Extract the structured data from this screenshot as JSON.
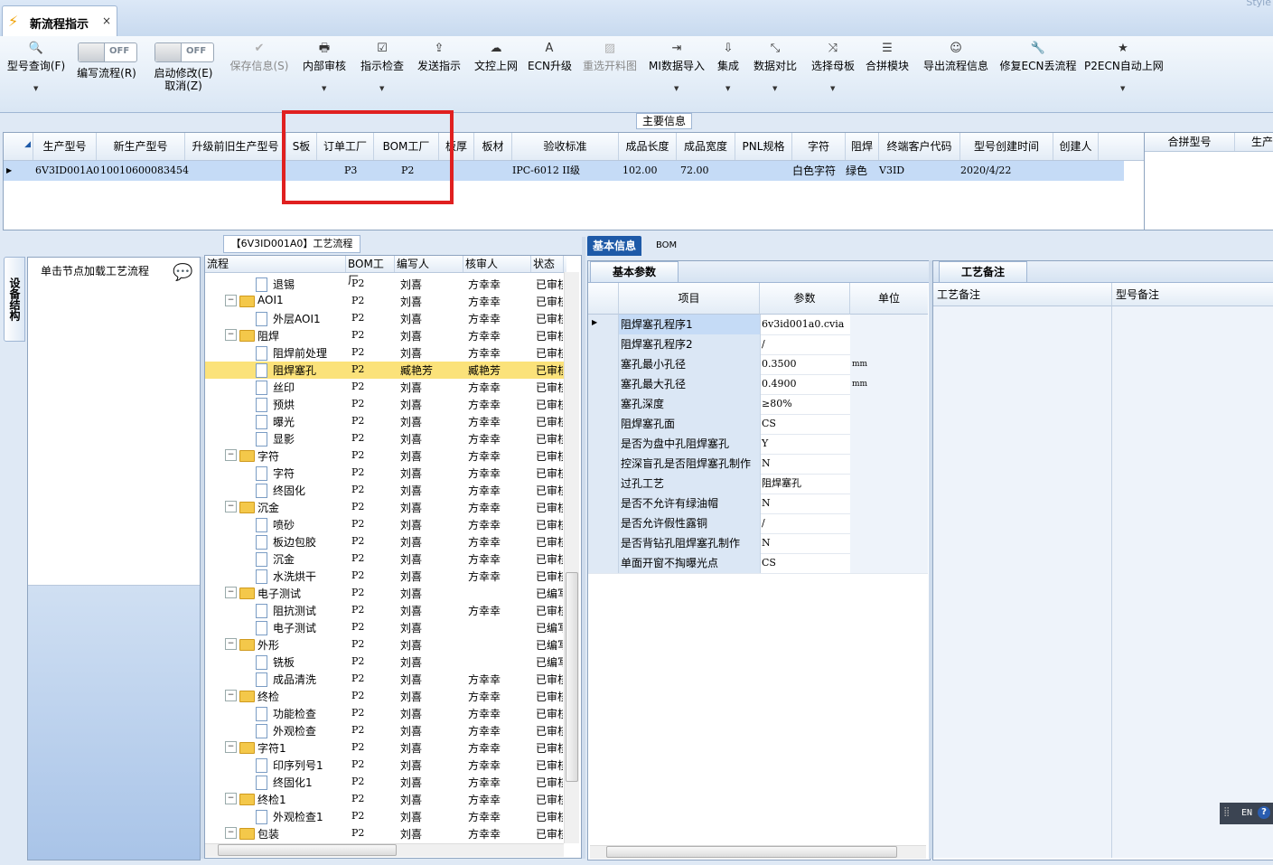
{
  "window": {
    "tab_title": "新流程指示",
    "close_glyph": "×",
    "style_label": "Style"
  },
  "toolbar": {
    "items": [
      {
        "label": "型号查询(F)",
        "icon": "🔍",
        "dropdown": true
      },
      {
        "label": "编写流程(R)",
        "toggle": "OFF"
      },
      {
        "label": "启动修改(E)",
        "label2": "取消(Z)",
        "toggle": "OFF"
      },
      {
        "label": "保存信息(S)",
        "icon": "✔",
        "disabled": true
      },
      {
        "label": "内部审核",
        "icon": "🖶",
        "dropdown": true
      },
      {
        "label": "指示检查",
        "icon": "☑",
        "dropdown": true
      },
      {
        "label": "发送指示",
        "icon": "⇪"
      },
      {
        "label": "文控上网",
        "icon": "☁"
      },
      {
        "label": "ECN升级",
        "icon": "A"
      },
      {
        "label": "重选开料图",
        "icon": "▨",
        "disabled": true
      },
      {
        "label": "MI数据导入",
        "icon": "⇥",
        "dropdown": true
      },
      {
        "label": "集成",
        "icon": "⇩",
        "dropdown": true
      },
      {
        "label": "数据对比",
        "icon": "⤡",
        "dropdown": true
      },
      {
        "label": "选择母板",
        "icon": "⤨",
        "dropdown": true
      },
      {
        "label": "合拼模块",
        "icon": "☰"
      },
      {
        "label": "导出流程信息",
        "icon": "☺"
      },
      {
        "label": "修复ECN丢流程",
        "icon": "🔧"
      },
      {
        "label": "P2ECN自动上网",
        "icon": "★",
        "dropdown": true
      }
    ]
  },
  "main_info": {
    "title": "主要信息",
    "columns": [
      "生产型号",
      "新生产型号",
      "升级前旧生产型号",
      "S板",
      "订单工厂",
      "BOM工厂",
      "板厚",
      "板材",
      "验收标准",
      "成品长度",
      "成品宽度",
      "PNL规格",
      "字符",
      "阻焊",
      "终端客户代码",
      "型号创建时间",
      "创建人"
    ],
    "row": [
      "6V3ID001A0",
      "10010600083454",
      "",
      "",
      "P3",
      "P2",
      "",
      "",
      "IPC-6012 II级",
      "102.00",
      "72.00",
      "",
      "白色字符",
      "绿色",
      "V3ID",
      "2020/4/22",
      ""
    ],
    "merge_columns": [
      "合拼型号",
      "生产"
    ]
  },
  "left_panel": {
    "side_tab": "设备结构",
    "load_hint": "单击节点加载工艺流程"
  },
  "tree": {
    "title": "【6V3ID001A0】工艺流程",
    "columns": [
      "流程",
      "BOM工厂",
      "编写人",
      "核审人",
      "状态"
    ],
    "rows": [
      {
        "level": 2,
        "name": "退锡",
        "bom": "P2",
        "writer": "刘喜",
        "reviewer": "方幸幸",
        "status": "已审核"
      },
      {
        "level": 1,
        "name": "AOI1",
        "bom": "P2",
        "writer": "刘喜",
        "reviewer": "方幸幸",
        "status": "已审核"
      },
      {
        "level": 2,
        "name": "外层AOI1",
        "bom": "P2",
        "writer": "刘喜",
        "reviewer": "方幸幸",
        "status": "已审核"
      },
      {
        "level": 1,
        "name": "阻焊",
        "bom": "P2",
        "writer": "刘喜",
        "reviewer": "方幸幸",
        "status": "已审核"
      },
      {
        "level": 2,
        "name": "阻焊前处理",
        "bom": "P2",
        "writer": "刘喜",
        "reviewer": "方幸幸",
        "status": "已审核"
      },
      {
        "level": 2,
        "name": "阻焊塞孔",
        "bom": "P2",
        "writer": "臧艳芳",
        "reviewer": "臧艳芳",
        "status": "已审核",
        "selected": true
      },
      {
        "level": 2,
        "name": "丝印",
        "bom": "P2",
        "writer": "刘喜",
        "reviewer": "方幸幸",
        "status": "已审核"
      },
      {
        "level": 2,
        "name": "预烘",
        "bom": "P2",
        "writer": "刘喜",
        "reviewer": "方幸幸",
        "status": "已审核"
      },
      {
        "level": 2,
        "name": "曝光",
        "bom": "P2",
        "writer": "刘喜",
        "reviewer": "方幸幸",
        "status": "已审核"
      },
      {
        "level": 2,
        "name": "显影",
        "bom": "P2",
        "writer": "刘喜",
        "reviewer": "方幸幸",
        "status": "已审核"
      },
      {
        "level": 1,
        "name": "字符",
        "bom": "P2",
        "writer": "刘喜",
        "reviewer": "方幸幸",
        "status": "已审核"
      },
      {
        "level": 2,
        "name": "字符",
        "bom": "P2",
        "writer": "刘喜",
        "reviewer": "方幸幸",
        "status": "已审核"
      },
      {
        "level": 2,
        "name": "终固化",
        "bom": "P2",
        "writer": "刘喜",
        "reviewer": "方幸幸",
        "status": "已审核"
      },
      {
        "level": 1,
        "name": "沉金",
        "bom": "P2",
        "writer": "刘喜",
        "reviewer": "方幸幸",
        "status": "已审核"
      },
      {
        "level": 2,
        "name": "喷砂",
        "bom": "P2",
        "writer": "刘喜",
        "reviewer": "方幸幸",
        "status": "已审核"
      },
      {
        "level": 2,
        "name": "板边包胶",
        "bom": "P2",
        "writer": "刘喜",
        "reviewer": "方幸幸",
        "status": "已审核"
      },
      {
        "level": 2,
        "name": "沉金",
        "bom": "P2",
        "writer": "刘喜",
        "reviewer": "方幸幸",
        "status": "已审核"
      },
      {
        "level": 2,
        "name": "水洗烘干",
        "bom": "P2",
        "writer": "刘喜",
        "reviewer": "方幸幸",
        "status": "已审核"
      },
      {
        "level": 1,
        "name": "电子测试",
        "bom": "P2",
        "writer": "刘喜",
        "reviewer": "",
        "status": "已编写"
      },
      {
        "level": 2,
        "name": "阻抗测试",
        "bom": "P2",
        "writer": "刘喜",
        "reviewer": "方幸幸",
        "status": "已审核"
      },
      {
        "level": 2,
        "name": "电子测试",
        "bom": "P2",
        "writer": "刘喜",
        "reviewer": "",
        "status": "已编写"
      },
      {
        "level": 1,
        "name": "外形",
        "bom": "P2",
        "writer": "刘喜",
        "reviewer": "",
        "status": "已编写"
      },
      {
        "level": 2,
        "name": "铣板",
        "bom": "P2",
        "writer": "刘喜",
        "reviewer": "",
        "status": "已编写"
      },
      {
        "level": 2,
        "name": "成品清洗",
        "bom": "P2",
        "writer": "刘喜",
        "reviewer": "方幸幸",
        "status": "已审核"
      },
      {
        "level": 1,
        "name": "终检",
        "bom": "P2",
        "writer": "刘喜",
        "reviewer": "方幸幸",
        "status": "已审核"
      },
      {
        "level": 2,
        "name": "功能检查",
        "bom": "P2",
        "writer": "刘喜",
        "reviewer": "方幸幸",
        "status": "已审核"
      },
      {
        "level": 2,
        "name": "外观检查",
        "bom": "P2",
        "writer": "刘喜",
        "reviewer": "方幸幸",
        "status": "已审核"
      },
      {
        "level": 1,
        "name": "字符1",
        "bom": "P2",
        "writer": "刘喜",
        "reviewer": "方幸幸",
        "status": "已审核"
      },
      {
        "level": 2,
        "name": "印序列号1",
        "bom": "P2",
        "writer": "刘喜",
        "reviewer": "方幸幸",
        "status": "已审核"
      },
      {
        "level": 2,
        "name": "终固化1",
        "bom": "P2",
        "writer": "刘喜",
        "reviewer": "方幸幸",
        "status": "已审核"
      },
      {
        "level": 1,
        "name": "终检1",
        "bom": "P2",
        "writer": "刘喜",
        "reviewer": "方幸幸",
        "status": "已审核"
      },
      {
        "level": 2,
        "name": "外观检查1",
        "bom": "P2",
        "writer": "刘喜",
        "reviewer": "方幸幸",
        "status": "已审核"
      },
      {
        "level": 1,
        "name": "包装",
        "bom": "P2",
        "writer": "刘喜",
        "reviewer": "方幸幸",
        "status": "已审核"
      }
    ]
  },
  "info_tabs": [
    "基本信息",
    "BOM"
  ],
  "basic_params": {
    "tab": "基本参数",
    "columns": [
      "项目",
      "参数",
      "单位"
    ],
    "rows": [
      {
        "item": "阻焊塞孔程序1",
        "value": "6v3id001a0.cvia",
        "unit": ""
      },
      {
        "item": "阻焊塞孔程序2",
        "value": "/",
        "unit": ""
      },
      {
        "item": "塞孔最小孔径",
        "value": "0.3500",
        "unit": "mm"
      },
      {
        "item": "塞孔最大孔径",
        "value": "0.4900",
        "unit": "mm"
      },
      {
        "item": "塞孔深度",
        "value": "≥80%",
        "unit": ""
      },
      {
        "item": "阻焊塞孔面",
        "value": "CS",
        "unit": ""
      },
      {
        "item": "是否为盘中孔阻焊塞孔",
        "value": "Y",
        "unit": ""
      },
      {
        "item": "控深盲孔是否阻焊塞孔制作",
        "value": "N",
        "unit": ""
      },
      {
        "item": "过孔工艺",
        "value": "阻焊塞孔",
        "unit": ""
      },
      {
        "item": "是否不允许有绿油帽",
        "value": "N",
        "unit": ""
      },
      {
        "item": "是否允许假性露铜",
        "value": "/",
        "unit": ""
      },
      {
        "item": "是否背钻孔阻焊塞孔制作",
        "value": "N",
        "unit": ""
      },
      {
        "item": "单面开窗不掏曝光点",
        "value": "CS",
        "unit": ""
      }
    ]
  },
  "notes": {
    "tab": "工艺备注",
    "col1": "工艺备注",
    "col2": "型号备注"
  },
  "lang_bar": {
    "lang": "EN",
    "help": "?"
  }
}
